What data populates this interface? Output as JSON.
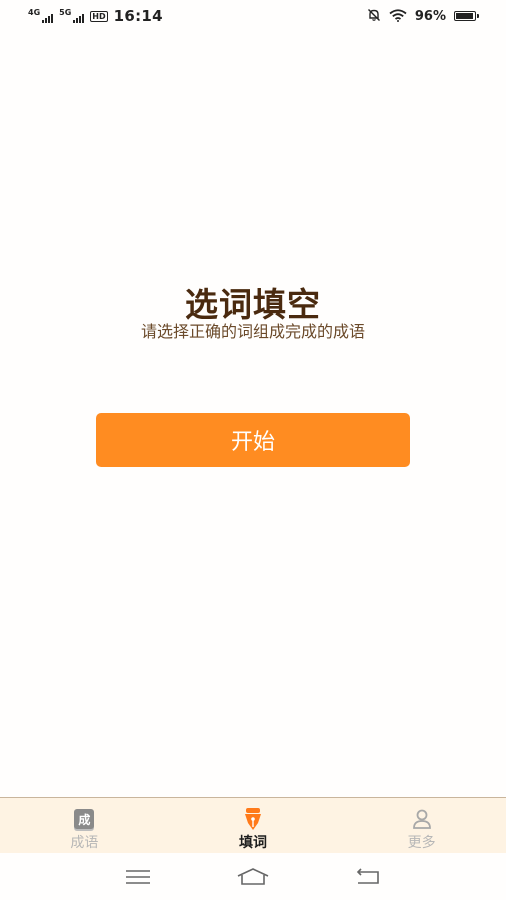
{
  "status_bar": {
    "network1": "4G",
    "network2": "5G",
    "hd": "HD",
    "time": "16:14",
    "battery": "96%"
  },
  "main": {
    "title": "选词填空",
    "subtitle": "请选择正确的词组成完成的成语",
    "start_label": "开始"
  },
  "tabs": [
    {
      "label": "成语",
      "icon": "idiom-book-icon",
      "icon_char": "成",
      "active": false
    },
    {
      "label": "填词",
      "icon": "fountain-pen-icon",
      "active": true
    },
    {
      "label": "更多",
      "icon": "person-icon",
      "active": false
    }
  ],
  "colors": {
    "accent": "#ff8c21",
    "title": "#4a2a0f",
    "tab_bar_bg": "#fef3e3",
    "tab_active": "#ff7a1a"
  }
}
